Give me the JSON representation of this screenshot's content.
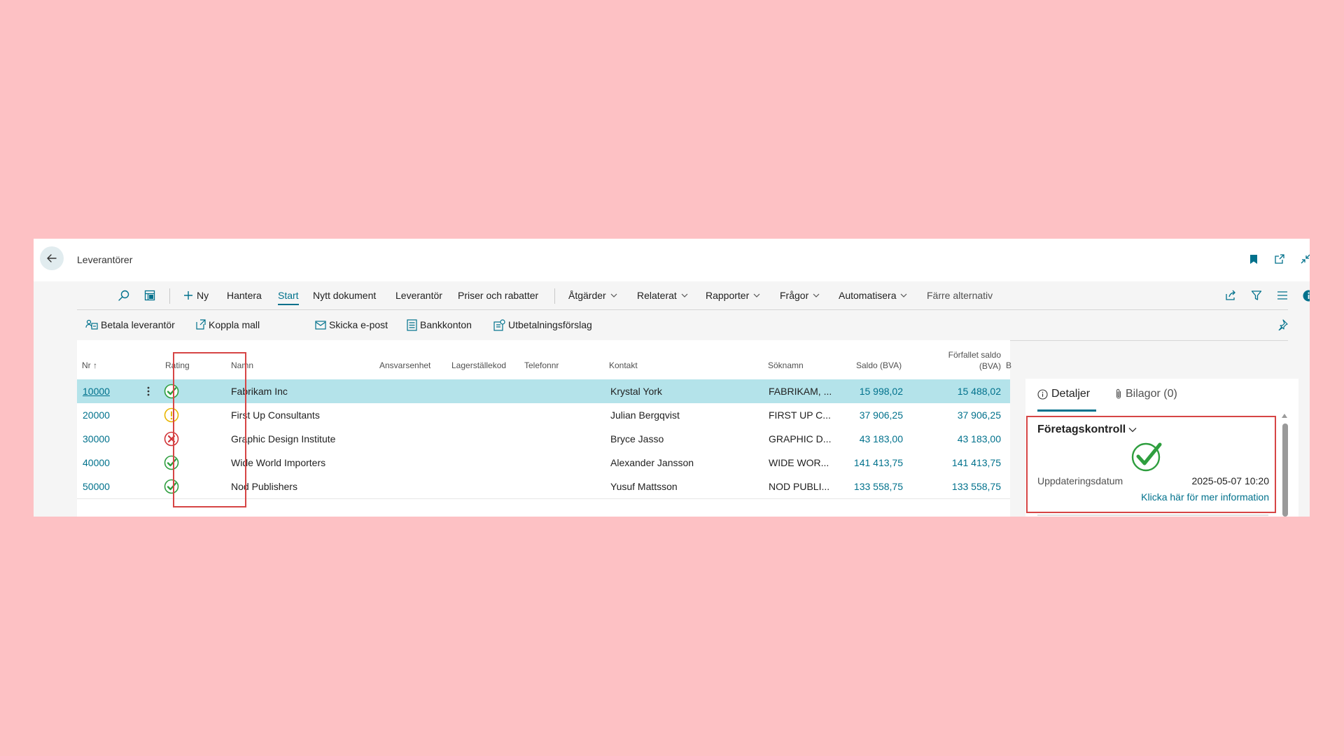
{
  "window": {
    "title": "Leverantörer"
  },
  "actions": [
    {
      "label": "Ny",
      "icon": "plus-icon"
    },
    {
      "label": "Hantera"
    },
    {
      "label": "Start",
      "active": true
    },
    {
      "label": "Nytt dokument"
    },
    {
      "label": "Leverantör"
    },
    {
      "label": "Priser och rabatter"
    },
    {
      "label": "Åtgärder",
      "dropdown": true
    },
    {
      "label": "Relaterat",
      "dropdown": true
    },
    {
      "label": "Rapporter",
      "dropdown": true
    },
    {
      "label": "Frågor",
      "dropdown": true
    },
    {
      "label": "Automatisera",
      "dropdown": true
    },
    {
      "label": "Färre alternativ"
    }
  ],
  "promoted": [
    {
      "label": "Betala leverantör",
      "icon": "pay-vendor-icon"
    },
    {
      "label": "Koppla mall",
      "icon": "apply-template-icon"
    },
    {
      "label": "Skicka e-post",
      "icon": "email-icon"
    },
    {
      "label": "Bankkonton",
      "icon": "bank-accounts-icon"
    },
    {
      "label": "Utbetalningsförslag",
      "icon": "payment-suggestion-icon"
    }
  ],
  "columns": {
    "nr": "Nr",
    "nr_sort": "↑",
    "rating": "Rating",
    "namn": "Namn",
    "ansvarsenhet": "Ansvarsenhet",
    "lagerstallekod": "Lagerställekod",
    "telefonnr": "Telefonnr",
    "kontakt": "Kontakt",
    "soknamn": "Söknamn",
    "saldo": "Saldo (BVA)",
    "forfallet_1": "Förfallet saldo",
    "forfallet_2": "(BVA)",
    "b": "B"
  },
  "rows": [
    {
      "nr": "10000",
      "rating": "check",
      "namn": "Fabrikam Inc",
      "kontakt": "Krystal York",
      "soknamn": "FABRIKAM, ...",
      "saldo": "15 998,02",
      "forfallet": "15 488,02",
      "selected": true
    },
    {
      "nr": "20000",
      "rating": "warning",
      "namn": "First Up Consultants",
      "kontakt": "Julian Bergqvist",
      "soknamn": "FIRST UP C...",
      "saldo": "37 906,25",
      "forfallet": "37 906,25",
      "selected": false
    },
    {
      "nr": "30000",
      "rating": "error",
      "namn": "Graphic Design Institute",
      "kontakt": "Bryce Jasso",
      "soknamn": "GRAPHIC D...",
      "saldo": "43 183,00",
      "forfallet": "43 183,00",
      "selected": false
    },
    {
      "nr": "40000",
      "rating": "check",
      "namn": "Wide World Importers",
      "kontakt": "Alexander Jansson",
      "soknamn": "WIDE WOR...",
      "saldo": "141 413,75",
      "forfallet": "141 413,75",
      "selected": false
    },
    {
      "nr": "50000",
      "rating": "check",
      "namn": "Nod Publishers",
      "kontakt": "Yusuf Mattsson",
      "soknamn": "NOD PUBLI...",
      "saldo": "133 558,75",
      "forfallet": "133 558,75",
      "selected": false
    }
  ],
  "factbox": {
    "tabs": [
      {
        "label": "Detaljer",
        "active": true
      },
      {
        "label": "Bilagor (0)"
      }
    ],
    "section_title": "Företagskontroll",
    "status_icon": "check-circle-icon",
    "update_label": "Uppdateringsdatum",
    "update_value": "2025-05-07 10:20",
    "info_link": "Klicka här för mer information"
  },
  "colors": {
    "accent": "#00718c",
    "selected_row": "#b4e3ea",
    "highlight_box": "#d64545",
    "ok": "#2e9e3e",
    "warning": "#e8b500",
    "error": "#d13438",
    "background": "#fdc1c4"
  }
}
